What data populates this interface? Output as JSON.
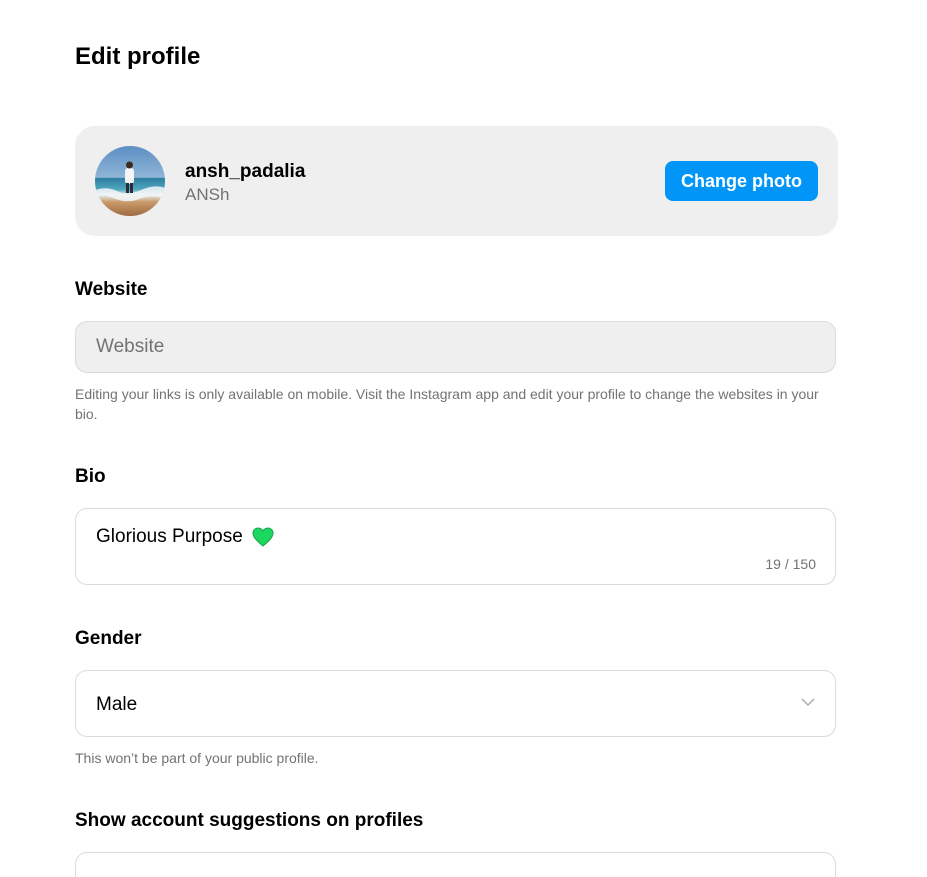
{
  "page": {
    "title": "Edit profile"
  },
  "profile": {
    "username": "ansh_padalia",
    "full_name": "ANSh",
    "change_photo_label": "Change photo",
    "avatar_icon": "avatar-photo"
  },
  "website": {
    "label": "Website",
    "placeholder": "Website",
    "value": "",
    "helper": "Editing your links is only available on mobile. Visit the Instagram app and edit your profile to change the websites in your bio."
  },
  "bio": {
    "label": "Bio",
    "value": "Glorious Purpose",
    "emoji_icon": "green-heart-icon",
    "counter": "19 / 150"
  },
  "gender": {
    "label": "Gender",
    "selected": "Male",
    "helper": "This won’t be part of your public profile."
  },
  "suggestions": {
    "label": "Show account suggestions on profiles"
  },
  "colors": {
    "accent": "#0095f6",
    "card_bg": "#efefef",
    "muted_text": "#737373",
    "border": "#dbdbdb",
    "heart": "#1ed760"
  }
}
